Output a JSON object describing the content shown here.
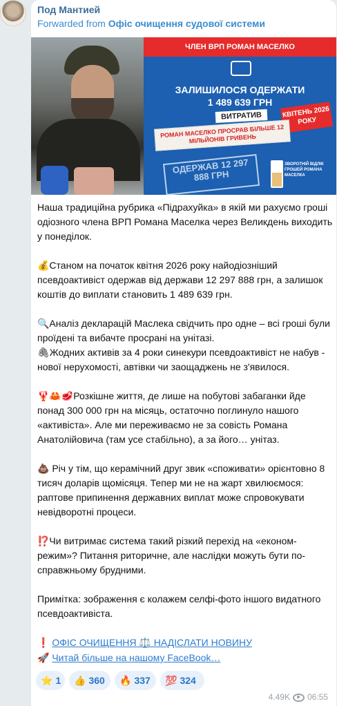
{
  "channel": {
    "name": "Под Мантией"
  },
  "forward": {
    "prefix": "Forwarded from ",
    "source": "Офіс очищення судової системи"
  },
  "image": {
    "top_banner": "ЧЛЕН ВРП РОМАН МАСЕЛКО",
    "remaining_label": "ЗАЛИШИЛОСЯ ОДЕРЖАТИ",
    "remaining_value": "1 489 639 ГРН",
    "spent_label": "ВИТРАТИВ",
    "slip_text": "РОМАН МАСЕЛКО ПРОСРАВ БІЛЬШЕ 12 МІЛЬЙОНІВ ГРИВЕНЬ",
    "deadline": "КВІТЕНЬ 2026 РОКУ",
    "received_stamp": "ОДЕРЖАВ 12 297 888 ГРН",
    "countdown_text": "ЗВОРОТНІЙ ВІДЛІК ГРОШЕЙ РОМАНА МАСЕЛКА"
  },
  "message": {
    "paragraphs": [
      "Наша традиційна рубрика «Підрахуйка» в якій ми рахуємо гроші одіозного члена ВРП Романа Маселка через Великдень виходить у понеділок.",
      "💰Станом на початок квітня 2026 року найодіозніший псевдоактивіст одержав від держави 12 297 888 грн, а залишок коштів до виплати становить 1 489 639 грн.",
      "🔍Аналіз декларацій Маслека свідчить про одне – всі гроші були проїдені та вибачте просрані на унітазі.",
      "🖇Жодних активів за 4 роки синекури псевдоактивіст не набув - нової нерухомості, автівки чи заощаджень не з'явилося.",
      "🦞🦀🥩Розкішне життя, де лише на побутові забаганки йде понад 300 000 грн на місяць, остаточно поглинуло нашого «активіста». Але ми переживаємо не за совість Романа Анатолійовича (там усе стабільно), а за його… унітаз.",
      "💩 Річ у тім, що керамічний друг звик «споживати» орієнтовно 8 тисяч доларів щомісяця. Тепер ми не на жарт хвилюємося: раптове припинення державних виплат може спровокувати невідворотні процеси.",
      "⁉️Чи витримає система такий різкий перехід на «економ-режим»? Питання риторичне, але наслідки можуть бути по-справжньому брудними.",
      "Примітка: зображення є колажем селфі-фото іншого видатного псевдоактивіста."
    ],
    "footer1_emoji": "❗",
    "footer1_link": "ОФІС ОЧИЩЕННЯ ⚖️ НАДІСЛАТИ НОВИНУ",
    "footer2_emoji": "🚀",
    "footer2_link": "Читай більше на нашому FaceBook…"
  },
  "reactions": [
    {
      "emoji": "⭐",
      "count": "1"
    },
    {
      "emoji": "👍",
      "count": "360"
    },
    {
      "emoji": "🔥",
      "count": "337"
    },
    {
      "emoji": "💯",
      "count": "324"
    }
  ],
  "meta": {
    "views": "4.49K",
    "time": "06:55"
  }
}
